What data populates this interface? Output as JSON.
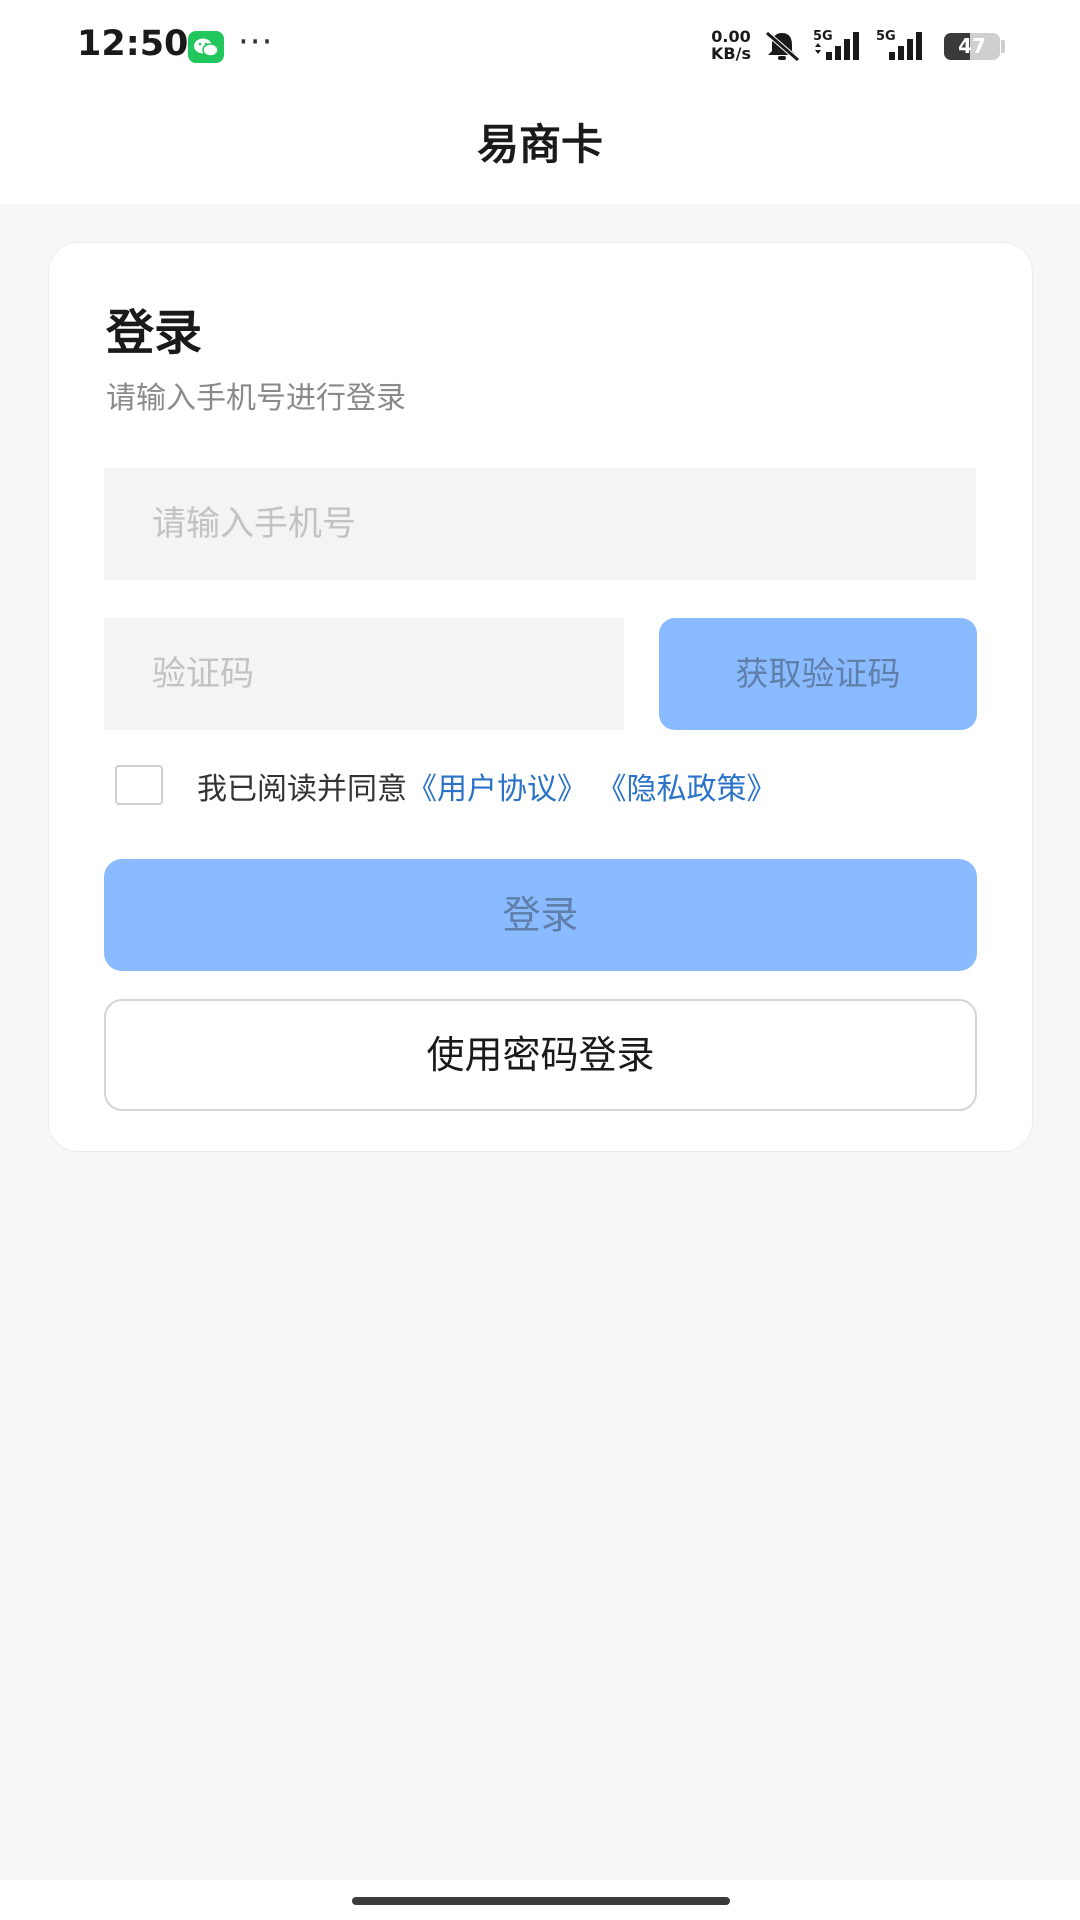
{
  "status_bar": {
    "time": "12:50",
    "dots": "···",
    "net_speed_value": "0.00",
    "net_speed_unit": "KB/s",
    "sim1_label": "5G",
    "sim2_label": "5G",
    "battery_level": "47",
    "battery_fraction": 0.47,
    "icons": [
      "wechat-icon",
      "more-icon",
      "mute-icon",
      "signal-5g-icon",
      "signal-5g-icon",
      "battery-icon"
    ]
  },
  "nav": {
    "title": "易商卡"
  },
  "login": {
    "title": "登录",
    "subtitle": "请输入手机号进行登录",
    "phone_placeholder": "请输入手机号",
    "code_placeholder": "验证码",
    "get_code_label": "获取验证码",
    "agree_prefix": "我已阅读并同意",
    "user_agreement": "《用户协议》",
    "privacy_policy": "《隐私政策》",
    "agree_checked": false,
    "login_label": "登录",
    "password_login_label": "使用密码登录"
  },
  "colors": {
    "primary_disabled": "#8abaff",
    "link": "#2a73c8",
    "background": "#f7f7f7",
    "wechat_green": "#21c65d"
  }
}
